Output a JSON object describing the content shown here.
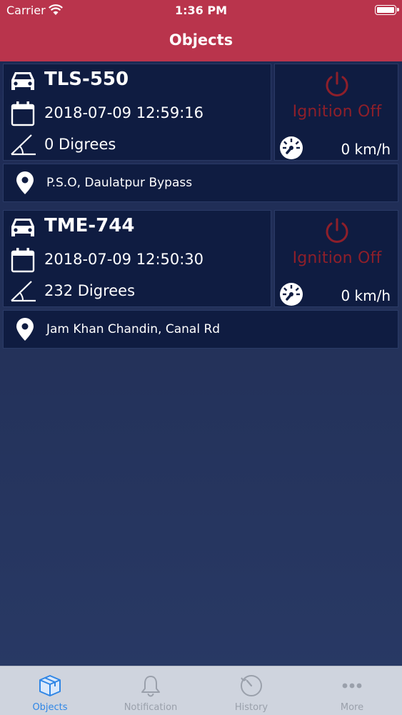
{
  "status_bar": {
    "carrier": "Carrier",
    "time": "1:36 PM"
  },
  "header": {
    "title": "Objects"
  },
  "objects": [
    {
      "plate": "TLS-550",
      "datetime": "2018-07-09 12:59:16",
      "heading": "0 Digrees",
      "ignition": "Ignition Off",
      "speed": "0 km/h",
      "address": "P.S.O, Daulatpur Bypass"
    },
    {
      "plate": "TME-744",
      "datetime": "2018-07-09 12:50:30",
      "heading": "232 Digrees",
      "ignition": "Ignition Off",
      "speed": "0 km/h",
      "address": "Jam Khan Chandin, Canal Rd"
    }
  ],
  "tabs": [
    {
      "label": "Objects",
      "icon": "box-icon",
      "active": true
    },
    {
      "label": "Notification",
      "icon": "bell-icon",
      "active": false
    },
    {
      "label": "History",
      "icon": "clock-icon",
      "active": false
    },
    {
      "label": "More",
      "icon": "more-dots-icon",
      "active": false
    }
  ],
  "colors": {
    "header_bg": "#b9344c",
    "card_bg": "#0f1c41",
    "ignition_off": "#8e1f2a",
    "tab_active": "#2f86e6",
    "tab_inactive": "#9aa0ab"
  }
}
